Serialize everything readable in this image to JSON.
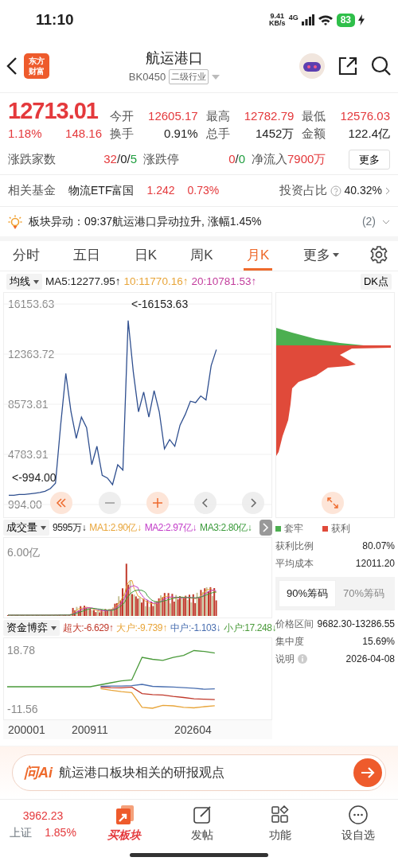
{
  "status_bar": {
    "time": "11:10",
    "speed": "9.41",
    "speed_unit": "KB/s",
    "network": "4G",
    "battery": "83",
    "charging": true
  },
  "header": {
    "logo": "东方财富",
    "title": "航运港口",
    "code": "BK0450",
    "tag": "二级行业"
  },
  "quote": {
    "price": "12713.01",
    "change_pct": "1.18%",
    "change": "148.16",
    "color": "#e4393c",
    "stats": [
      {
        "label": "今开",
        "value": "12605.17",
        "color": "#e4393c"
      },
      {
        "label": "最高",
        "value": "12782.79",
        "color": "#e4393c"
      },
      {
        "label": "最低",
        "value": "12576.03",
        "color": "#e4393c"
      },
      {
        "label": "换手",
        "value": "0.91%",
        "color": "#222222"
      },
      {
        "label": "总手",
        "value": "1452万",
        "color": "#222222"
      },
      {
        "label": "金额",
        "value": "122.4亿",
        "color": "#222222"
      }
    ],
    "breadth": [
      {
        "label": "涨跌家数",
        "parts": [
          {
            "text": "32",
            "color": "#e4393c"
          },
          {
            "text": "/0/",
            "color": "#222222"
          },
          {
            "text": "5",
            "color": "#1e9d3e"
          }
        ]
      },
      {
        "label": "涨跌停",
        "parts": [
          {
            "text": "0",
            "color": "#e4393c"
          },
          {
            "text": "/",
            "color": "#222222"
          },
          {
            "text": "0",
            "color": "#1e9d3e"
          }
        ]
      }
    ],
    "net_inflow": {
      "label": "净流入",
      "value": "7900万",
      "color": "#e4393c"
    },
    "more_button": "更多"
  },
  "fund": {
    "label": "相关基金",
    "name": "物流ETF富国",
    "price": "1.242",
    "change": "0.73%",
    "color": "#e4393c",
    "ratio_label": "投资占比",
    "ratio": "40.32%"
  },
  "alert": {
    "text": "板块异动：09:37航运港口异动拉升, 涨幅1.45%",
    "count": "(2)"
  },
  "tabs": [
    {
      "label": "分时",
      "selected": false
    },
    {
      "label": "五日",
      "selected": false
    },
    {
      "label": "日K",
      "selected": false
    },
    {
      "label": "周K",
      "selected": false
    },
    {
      "label": "月K",
      "selected": true
    },
    {
      "label": "更多",
      "selected": false,
      "dropdown": true
    }
  ],
  "ma_bar": {
    "selector": "均线",
    "items": [
      {
        "text": "MA5:12277.95↑",
        "color": "#222222"
      },
      {
        "text": "10:11770.16↑",
        "color": "#e8a53a"
      },
      {
        "text": "20:10781.53↑",
        "color": "#c23c9c"
      }
    ],
    "dk_button": "DK点"
  },
  "price_chart": {
    "chart_data": {
      "type": "line",
      "ylim": [
        994,
        16153.63
      ],
      "grid": true,
      "yticks": [
        {
          "value": 16153.63,
          "label": "16153.63"
        },
        {
          "value": 12363.72,
          "label": "12363.72"
        },
        {
          "value": 8573.81,
          "label": "8573.81"
        },
        {
          "value": 4783.91,
          "label": "4783.91"
        },
        {
          "value": 994,
          "label": "994.00"
        }
      ],
      "series": [
        {
          "color": "#2f4f8f",
          "values": [
            1700,
            1700,
            1750,
            1750,
            1800,
            1850,
            1900,
            2000,
            2200,
            2600,
            7000,
            10900,
            8000,
            6000,
            7600,
            6800,
            4000,
            5400,
            3200,
            3000,
            2500,
            4000,
            3600,
            14900,
            11000,
            8000,
            9500,
            7600,
            9600,
            8000,
            5200,
            5900,
            5400,
            7000,
            7800,
            8800,
            8700,
            9200,
            8900,
            11500,
            12700,
            null,
            null,
            null,
            null,
            null,
            null,
            null,
            null,
            null,
            null
          ]
        }
      ],
      "annotations": [
        {
          "text": "<-16153.63"
        },
        {
          "text": "<-994.00"
        }
      ]
    }
  },
  "volume": {
    "selector": "成交量",
    "items": [
      {
        "text": "9595万↓",
        "color": "#222222"
      },
      {
        "text": "MA1:2.90亿↓",
        "color": "#e8a53a"
      },
      {
        "text": "MA2:2.97亿↓",
        "color": "#c23cc8"
      },
      {
        "text": "MA3:2.80亿↓",
        "color": "#3a9a3a"
      }
    ],
    "top_label": "6.00亿"
  },
  "capital_flow": {
    "selector": "资金博弈",
    "items": [
      {
        "text": "超大:-6.629↑",
        "color": "#c0392b"
      },
      {
        "text": "大户:-9.739↑",
        "color": "#e8a53a"
      },
      {
        "text": "中户:-1.103↓",
        "color": "#4a6fb0"
      },
      {
        "text": "小户:17.248↓",
        "color": "#4a9a3a"
      }
    ],
    "chart_data": {
      "type": "line",
      "ylim": [
        -16.7,
        24.8
      ],
      "yticks": [
        {
          "value": 18.78,
          "label": "18.78"
        },
        {
          "value": -11.56,
          "label": "-11.56"
        }
      ],
      "series": [
        {
          "color": "#c0392b",
          "values": [
            null,
            null,
            null,
            null,
            null,
            null,
            null,
            null,
            null,
            -0.3,
            -0.5,
            -0.6,
            -0.2,
            -3.5,
            -4,
            -4.2,
            -5,
            -5.5,
            -6.2,
            -6.4,
            -6.6,
            null,
            null,
            null,
            null,
            null
          ]
        },
        {
          "color": "#e8a53a",
          "values": [
            null,
            null,
            null,
            null,
            null,
            null,
            null,
            null,
            null,
            -1,
            -1.8,
            -2.5,
            -3,
            -10.5,
            -11,
            -9.5,
            -9.8,
            -10.5,
            -10.8,
            -10.2,
            -9.7,
            null,
            null,
            null,
            null,
            null
          ]
        },
        {
          "color": "#4a6fb0",
          "values": [
            null,
            null,
            null,
            null,
            null,
            null,
            null,
            null,
            null,
            0.2,
            0.3,
            0.3,
            0.5,
            1.2,
            0.2,
            0,
            -0.2,
            -0.5,
            -0.8,
            -1.3,
            -1.1,
            null,
            null,
            null,
            null,
            null
          ]
        },
        {
          "color": "#4a9a3a",
          "values": [
            0,
            0,
            0,
            0,
            0,
            0,
            0,
            0,
            0,
            1,
            2,
            3,
            3.5,
            15,
            14,
            13.5,
            15,
            16,
            18.5,
            18,
            17.2,
            null,
            null,
            null,
            null,
            null
          ]
        }
      ]
    },
    "x_labels": [
      "200001",
      "200911",
      "202604"
    ]
  },
  "chips": {
    "legend": [
      {
        "label": "套牢",
        "color": "#4caf50"
      },
      {
        "label": "获利",
        "color": "#e04a3a"
      }
    ],
    "stats": [
      {
        "label": "获利比例",
        "value": "80.07%"
      },
      {
        "label": "平均成本",
        "value": "12011.20"
      }
    ],
    "tabs": [
      {
        "label": "90%筹码",
        "selected": true
      },
      {
        "label": "70%筹码",
        "selected": false
      }
    ],
    "details": [
      {
        "label": "价格区间",
        "value": "9682.30-13286.55"
      },
      {
        "label": "集中度",
        "value": "15.69%"
      },
      {
        "label": "说明",
        "value": "2026-04-08",
        "info": true
      }
    ]
  },
  "ai_bar": {
    "logo": "问Ai",
    "prompt": "航运港口板块相关的研报观点"
  },
  "bottom_nav": {
    "index": {
      "value": "3962.23",
      "name": "上证",
      "change": "1.85%",
      "color": "#e4393c"
    },
    "items": [
      {
        "label": "买板块",
        "kind": "buy",
        "selected": true
      },
      {
        "label": "发帖",
        "kind": "post",
        "selected": false
      },
      {
        "label": "功能",
        "kind": "grid",
        "selected": false
      },
      {
        "label": "设自选",
        "kind": "more",
        "selected": false
      }
    ]
  }
}
